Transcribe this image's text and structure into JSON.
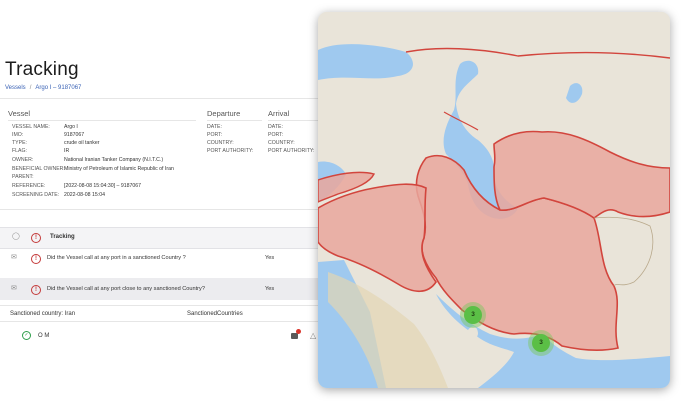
{
  "page": {
    "title": "Tracking",
    "breadcrumb": [
      "Vessels",
      "Argo I – 9187067"
    ]
  },
  "vessel": {
    "heading": "Vessel",
    "fields": [
      {
        "label": "Vessel name:",
        "value": "Argo I"
      },
      {
        "label": "IMO:",
        "value": "9187067"
      },
      {
        "label": "Type:",
        "value": "crude oil tanker"
      },
      {
        "label": "Flag:",
        "value": "IR"
      },
      {
        "label": "Owner:",
        "value": "National Iranian Tanker Company (N.I.T.C.)"
      },
      {
        "label": "Beneficial owner:",
        "value": "Ministry of Petroleum of Islamic Republic of Iran"
      },
      {
        "label": "Parent:",
        "value": ""
      },
      {
        "label": "Reference:",
        "value": "[2022-08-08 15:04:30] – 9187067"
      },
      {
        "label": "Screening date:",
        "value": "2022-08-08 15:04"
      }
    ]
  },
  "departure": {
    "heading": "Departure",
    "fields": [
      {
        "label": "Date:",
        "value": ""
      },
      {
        "label": "Port:",
        "value": ""
      },
      {
        "label": "Country:",
        "value": ""
      },
      {
        "label": "Port authority:",
        "value": ""
      }
    ]
  },
  "arrival": {
    "heading": "Arrival",
    "fields": [
      {
        "label": "Date:",
        "value": ""
      },
      {
        "label": "Port:",
        "value": ""
      },
      {
        "label": "Country:",
        "value": ""
      },
      {
        "label": "Port authority:",
        "value": ""
      }
    ]
  },
  "tracking": {
    "label": "Tracking",
    "questions": [
      {
        "text": "Did the Vessel call at any port in a sanctioned Country ?",
        "answer": "Yes"
      },
      {
        "text": "Did the Vessel call at any port close to any sanctioned Country?",
        "answer": "Yes"
      }
    ]
  },
  "sanctions": {
    "country_label": "Sanctioned country: Iran",
    "countries_label": "SanctionedCountries",
    "item": "O M"
  },
  "map": {
    "clusters": [
      {
        "count": "3"
      },
      {
        "count": "3"
      }
    ],
    "colors": {
      "sanctioned_fill": "#e9a79c",
      "sanctioned_border": "#d2453d",
      "water": "#9fc9ef",
      "land": "#e9e4d9",
      "cluster": "#5bbf46"
    }
  }
}
